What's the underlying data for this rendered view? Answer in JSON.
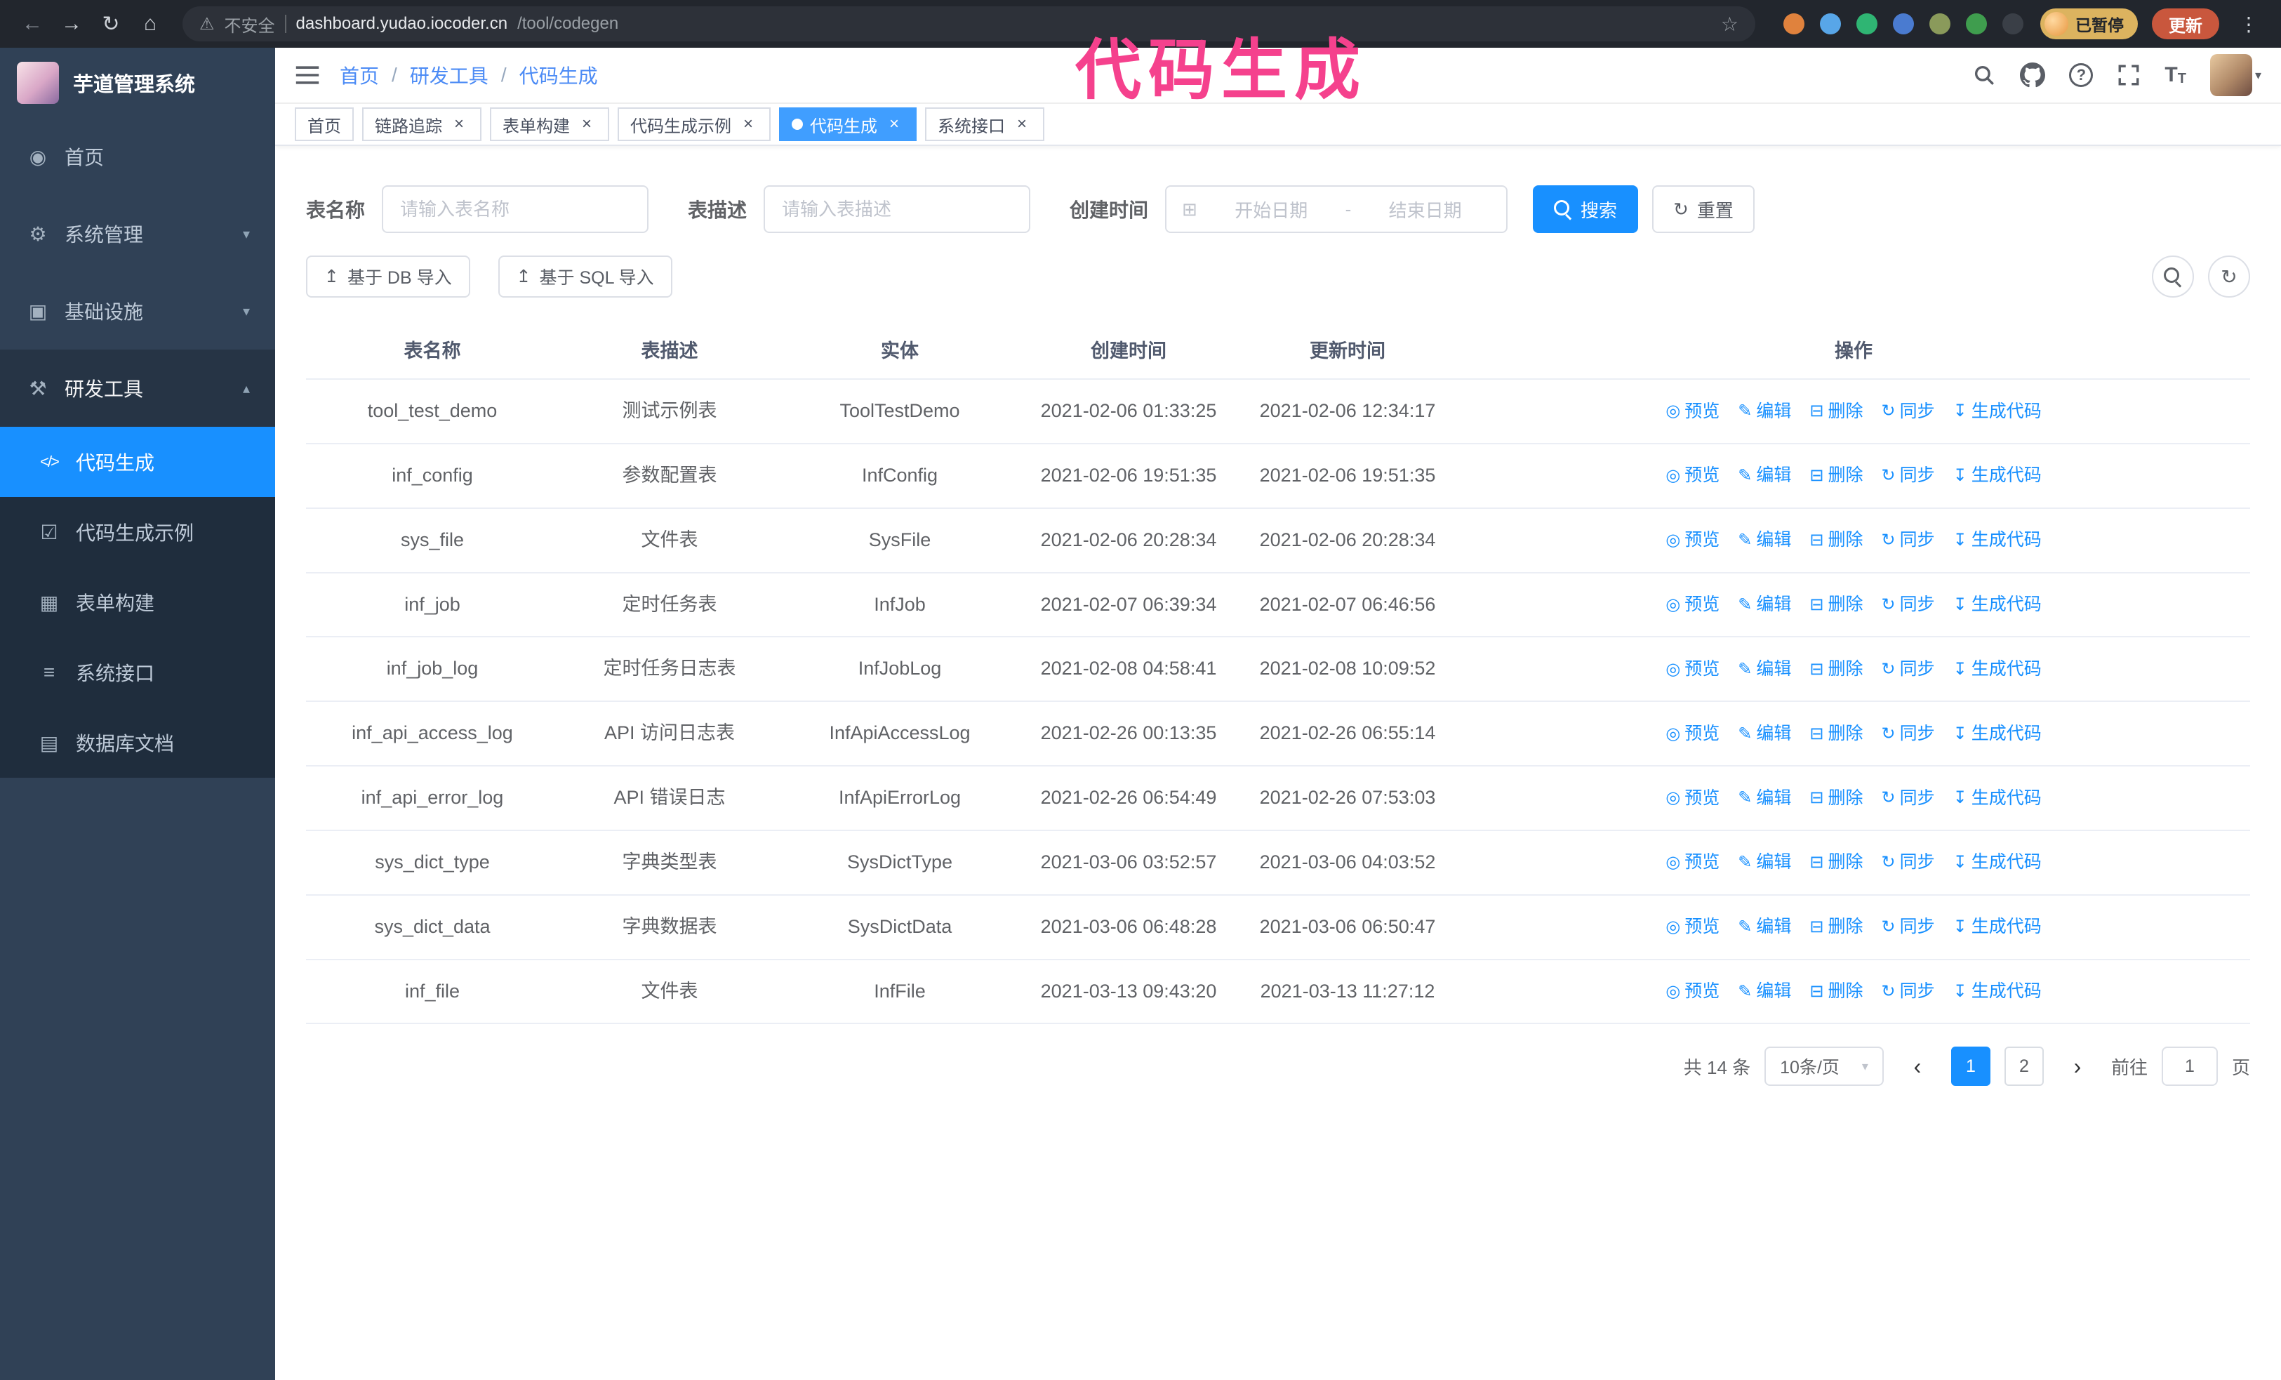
{
  "colors": {
    "accent": "#1890ff",
    "annotation": "#f5418d",
    "sidebar_bg": "#304156",
    "submenu_bg": "#1f2d3d"
  },
  "browser": {
    "security_label": "不安全",
    "url_domain": "dashboard.yudao.iocoder.cn",
    "url_path": "/tool/codegen",
    "paused_badge": "已暂停",
    "update_button": "更新"
  },
  "annotation": {
    "text": "代码生成"
  },
  "sidebar": {
    "logo_title": "芋道管理系统",
    "items": [
      {
        "label": "首页"
      },
      {
        "label": "系统管理"
      },
      {
        "label": "基础设施"
      },
      {
        "label": "研发工具"
      }
    ],
    "sub_items": [
      {
        "label": "代码生成"
      },
      {
        "label": "代码生成示例"
      },
      {
        "label": "表单构建"
      },
      {
        "label": "系统接口"
      },
      {
        "label": "数据库文档"
      }
    ]
  },
  "header": {
    "breadcrumb": [
      "首页",
      "研发工具",
      "代码生成"
    ],
    "separator": "/"
  },
  "tabs": [
    {
      "label": "首页"
    },
    {
      "label": "链路追踪"
    },
    {
      "label": "表单构建"
    },
    {
      "label": "代码生成示例"
    },
    {
      "label": "代码生成"
    },
    {
      "label": "系统接口"
    }
  ],
  "filters": {
    "table_name_label": "表名称",
    "table_name_placeholder": "请输入表名称",
    "table_desc_label": "表描述",
    "table_desc_placeholder": "请输入表描述",
    "create_time_label": "创建时间",
    "date_start_placeholder": "开始日期",
    "date_separator": "-",
    "date_end_placeholder": "结束日期",
    "search_button": "搜索",
    "reset_button": "重置"
  },
  "toolbar": {
    "import_db_button": "基于 DB 导入",
    "import_sql_button": "基于 SQL 导入"
  },
  "table": {
    "columns": [
      "表名称",
      "表描述",
      "实体",
      "创建时间",
      "更新时间",
      "操作"
    ],
    "actions": {
      "preview": "预览",
      "edit": "编辑",
      "delete": "删除",
      "sync": "同步",
      "generate": "生成代码"
    },
    "rows": [
      {
        "name": "tool_test_demo",
        "desc": "测试示例表",
        "entity": "ToolTestDemo",
        "created": "2021-02-06 01:33:25",
        "updated": "2021-02-06 12:34:17"
      },
      {
        "name": "inf_config",
        "desc": "参数配置表",
        "entity": "InfConfig",
        "created": "2021-02-06 19:51:35",
        "updated": "2021-02-06 19:51:35"
      },
      {
        "name": "sys_file",
        "desc": "文件表",
        "entity": "SysFile",
        "created": "2021-02-06 20:28:34",
        "updated": "2021-02-06 20:28:34"
      },
      {
        "name": "inf_job",
        "desc": "定时任务表",
        "entity": "InfJob",
        "created": "2021-02-07 06:39:34",
        "updated": "2021-02-07 06:46:56"
      },
      {
        "name": "inf_job_log",
        "desc": "定时任务日志表",
        "entity": "InfJobLog",
        "created": "2021-02-08 04:58:41",
        "updated": "2021-02-08 10:09:52"
      },
      {
        "name": "inf_api_access_log",
        "desc": "API 访问日志表",
        "entity": "InfApiAccessLog",
        "created": "2021-02-26 00:13:35",
        "updated": "2021-02-26 06:55:14"
      },
      {
        "name": "inf_api_error_log",
        "desc": "API 错误日志",
        "entity": "InfApiErrorLog",
        "created": "2021-02-26 06:54:49",
        "updated": "2021-02-26 07:53:03"
      },
      {
        "name": "sys_dict_type",
        "desc": "字典类型表",
        "entity": "SysDictType",
        "created": "2021-03-06 03:52:57",
        "updated": "2021-03-06 04:03:52"
      },
      {
        "name": "sys_dict_data",
        "desc": "字典数据表",
        "entity": "SysDictData",
        "created": "2021-03-06 06:48:28",
        "updated": "2021-03-06 06:50:47"
      },
      {
        "name": "inf_file",
        "desc": "文件表",
        "entity": "InfFile",
        "created": "2021-03-13 09:43:20",
        "updated": "2021-03-13 11:27:12"
      }
    ]
  },
  "pagination": {
    "total": "共 14 条",
    "page_size": "10条/页",
    "page_1": "1",
    "page_2": "2",
    "goto_label": "前往",
    "goto_value": "1",
    "page_unit": "页"
  },
  "icons": {
    "back": "←",
    "forward": "→",
    "reload": "↻",
    "home": "⌂",
    "warning": "⚠",
    "star": "☆",
    "kebab": "⋮",
    "close": "×",
    "dashboard": "◉",
    "system": "⚙",
    "infra": "▣",
    "tools": "⚒",
    "code": "</>",
    "example": "☑",
    "form": "▦",
    "api": "≡",
    "db_doc": "▤",
    "chevron_down": "▾",
    "chevron_up": "▴",
    "caret_down": "▾",
    "calendar": "⊞",
    "upload": "↥",
    "refresh": "↻",
    "eye": "◎",
    "edit": "✎",
    "trash": "⊟",
    "sync": "↻",
    "download": "↧",
    "prev": "‹",
    "next": "›",
    "question": "?"
  }
}
